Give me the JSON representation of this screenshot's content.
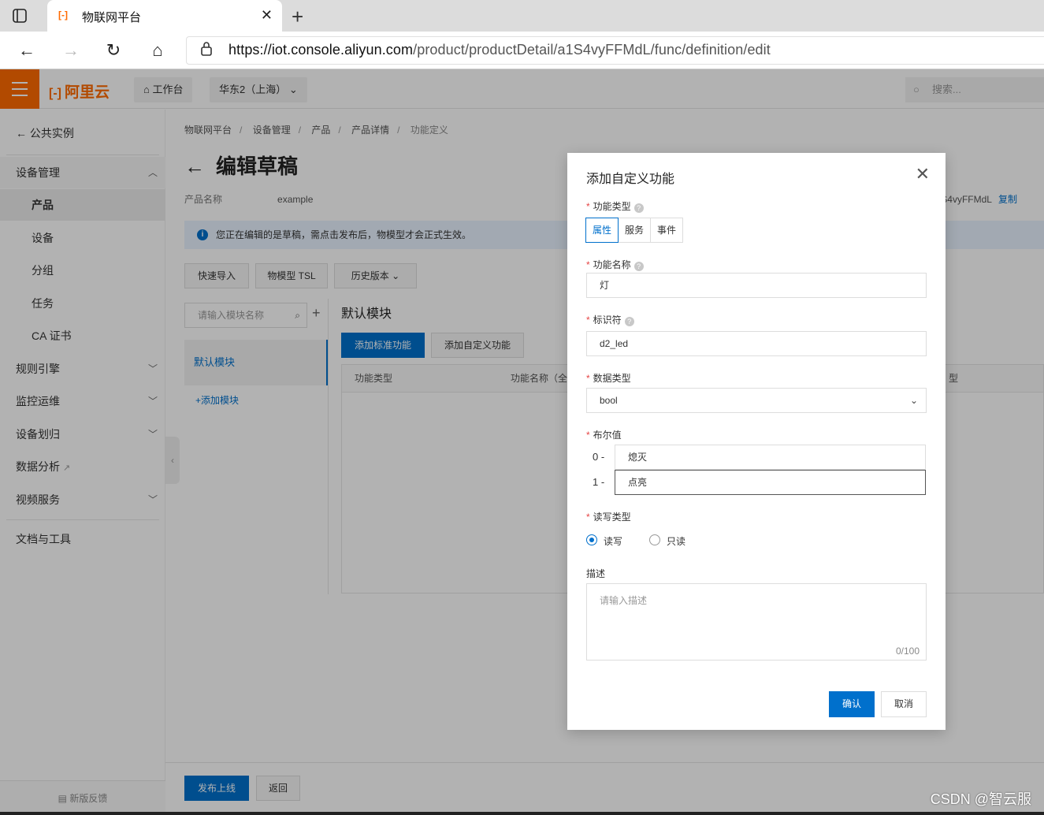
{
  "browser": {
    "tab_title": "物联网平台",
    "url_host": "https://iot.console.aliyun.com",
    "url_path": "/product/productDetail/a1S4vyFFMdL/func/definition/edit"
  },
  "topnav": {
    "brand": "阿里云",
    "workbench": "工作台",
    "region": "华东2（上海）",
    "search_placeholder": "搜索..."
  },
  "sidebar": {
    "back": "公共实例",
    "groups": [
      {
        "label": "设备管理"
      },
      {
        "label": "产品"
      },
      {
        "label": "设备"
      },
      {
        "label": "分组"
      },
      {
        "label": "任务"
      },
      {
        "label": "CA 证书"
      },
      {
        "label": "规则引擎"
      },
      {
        "label": "监控运维"
      },
      {
        "label": "设备划归"
      },
      {
        "label": "数据分析"
      },
      {
        "label": "视频服务"
      },
      {
        "label": "文档与工具"
      }
    ],
    "feedback": "新版反馈"
  },
  "main": {
    "breadcrumb": [
      "物联网平台",
      "设备管理",
      "产品",
      "产品详情",
      "功能定义"
    ],
    "title": "编辑草稿",
    "product_name_label": "产品名称",
    "product_name": "example",
    "product_key_partial": "S4vyFFMdL",
    "copy": "复制",
    "notice": "您正在编辑的是草稿，需点击发布后，物模型才会正式生效。",
    "btn_quick_import": "快速导入",
    "btn_tsl": "物模型 TSL",
    "btn_history": "历史版本",
    "module_search_placeholder": "请输入模块名称",
    "module_default": "默认模块",
    "add_module": "+添加模块",
    "module_title": "默认模块",
    "btn_add_standard": "添加标准功能",
    "btn_add_custom": "添加自定义功能",
    "col_type": "功能类型",
    "col_name": "功能名称（全",
    "col_tail": "型",
    "btn_publish": "发布上线",
    "btn_back": "返回"
  },
  "dialog": {
    "title": "添加自定义功能",
    "func_type_label": "功能类型",
    "func_types": [
      "属性",
      "服务",
      "事件"
    ],
    "func_name_label": "功能名称",
    "func_name_value": "灯",
    "identifier_label": "标识符",
    "identifier_value": "d2_led",
    "data_type_label": "数据类型",
    "data_type_value": "bool",
    "bool_label": "布尔值",
    "bool_0_idx": "0 -",
    "bool_0_value": "熄灭",
    "bool_1_idx": "1 -",
    "bool_1_value": "点亮",
    "rw_label": "读写类型",
    "rw_options": [
      "读写",
      "只读"
    ],
    "desc_label": "描述",
    "desc_placeholder": "请输入描述",
    "desc_counter": "0/100",
    "confirm": "确认",
    "cancel": "取消"
  },
  "watermark": "CSDN @智云服"
}
